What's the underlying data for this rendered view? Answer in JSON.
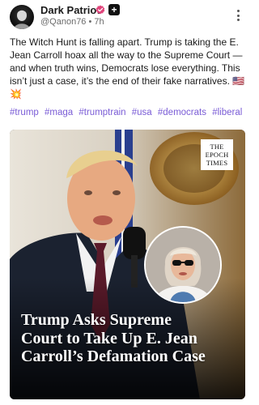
{
  "post": {
    "author": {
      "name": "Dark Patriot",
      "handle": "@Qanon76",
      "time": "7h",
      "separator": "•",
      "plus_badge": "+"
    },
    "text": "The Witch Hunt is falling apart. Trump is taking the E. Jean Carroll hoax all the way to the Supreme Court — and when truth wins, Democrats lose everything. This isn’t just a case, it’s the end of their fake narratives. 🇺🇸💥",
    "hashtags": [
      "#trump",
      "#maga",
      "#trumptrain",
      "#usa",
      "#democrats",
      "#liberal"
    ],
    "media": {
      "logo_line1": "THE",
      "logo_line2": "EPOCH",
      "logo_line3": "TIMES",
      "headline": "Trump Asks Supreme Court to Take Up E. Jean Carroll’s Defamation Case"
    }
  },
  "icons": {
    "verified": "verified-badge-icon",
    "menu": "more-vertical-icon"
  },
  "colors": {
    "hashtag": "#7a5cd6",
    "verified": "#e0457b",
    "text": "#1a1a1a",
    "meta": "#6b6b6b"
  }
}
